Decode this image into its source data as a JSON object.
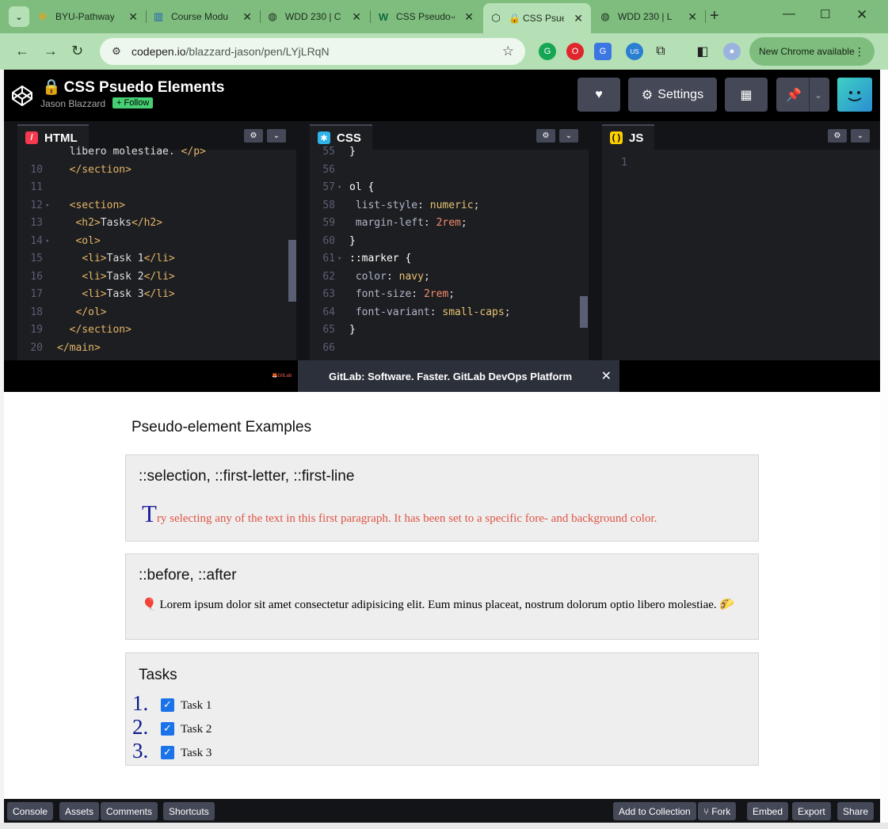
{
  "browser": {
    "tabs": [
      {
        "title": "BYU-Pathway",
        "icon": "byu-pathway-icon"
      },
      {
        "title": "Course Modu",
        "icon": "chart-bars-icon"
      },
      {
        "title": "WDD 230 | C",
        "icon": "globe-icon"
      },
      {
        "title": "CSS Pseudo-e",
        "icon": "w-icon"
      },
      {
        "title": "CSS Psued",
        "icon": "codepen-icon"
      },
      {
        "title": "WDD 230 | L",
        "icon": "globe-icon"
      }
    ],
    "address": {
      "host": "codepen.io",
      "path": "/blazzard-jason/pen/LYjLRqN"
    },
    "new_chrome_label": "New Chrome available",
    "extension_badge": "US"
  },
  "pen": {
    "title": "CSS Psuedo Elements",
    "author": "Jason Blazzard",
    "follow_label": "+ Follow",
    "settings_label": "Settings"
  },
  "editors": {
    "html": {
      "label": "HTML",
      "lines": [
        {
          "n": "",
          "fold": false,
          "text": "  libero molestiae. </p>"
        },
        {
          "n": "10",
          "fold": false,
          "text": "  </section>"
        },
        {
          "n": "11",
          "fold": false,
          "text": ""
        },
        {
          "n": "12",
          "fold": true,
          "text": "  <section>"
        },
        {
          "n": "13",
          "fold": false,
          "text": "   <h2>Tasks</h2>"
        },
        {
          "n": "14",
          "fold": true,
          "text": "   <ol>"
        },
        {
          "n": "15",
          "fold": false,
          "text": "    <li>Task 1</li>"
        },
        {
          "n": "16",
          "fold": false,
          "text": "    <li>Task 2</li>"
        },
        {
          "n": "17",
          "fold": false,
          "text": "    <li>Task 3</li>"
        },
        {
          "n": "18",
          "fold": false,
          "text": "   </ol>"
        },
        {
          "n": "19",
          "fold": false,
          "text": "  </section>"
        },
        {
          "n": "20",
          "fold": false,
          "text": "</main>"
        }
      ]
    },
    "css": {
      "label": "CSS",
      "lines": [
        {
          "n": "55",
          "fold": false,
          "text": "}"
        },
        {
          "n": "56",
          "fold": false,
          "text": ""
        },
        {
          "n": "57",
          "fold": true,
          "text": "ol {"
        },
        {
          "n": "58",
          "fold": false,
          "text": " list-style: numeric;"
        },
        {
          "n": "59",
          "fold": false,
          "text": " margin-left: 2rem;"
        },
        {
          "n": "60",
          "fold": false,
          "text": "}"
        },
        {
          "n": "61",
          "fold": true,
          "text": "::marker {"
        },
        {
          "n": "62",
          "fold": false,
          "text": " color: navy;"
        },
        {
          "n": "63",
          "fold": false,
          "text": " font-size: 2rem;"
        },
        {
          "n": "64",
          "fold": false,
          "text": " font-variant: small-caps;"
        },
        {
          "n": "65",
          "fold": false,
          "text": "}"
        },
        {
          "n": "66",
          "fold": false,
          "text": ""
        }
      ]
    },
    "js": {
      "label": "JS",
      "lines": [
        {
          "n": "1",
          "fold": false,
          "text": ""
        }
      ]
    }
  },
  "ad": {
    "small_label": "GitLab",
    "text": "GitLab: Software. Faster. GitLab DevOps Platform"
  },
  "preview": {
    "heading": "Pseudo-element Examples",
    "sections": [
      {
        "title": "::selection, ::first-letter, ::first-line",
        "first_letter": "T",
        "rest": "ry selecting any of the text in this first paragraph. It has been set to a specific fore- and background color."
      },
      {
        "title": "::before, ::after",
        "before_glyph": "🎈",
        "text": "Lorem ipsum dolor sit amet consectetur adipisicing elit. Eum minus placeat, nostrum dolorum optio libero molestiae.",
        "after_glyph": "🌮"
      },
      {
        "title": "Tasks",
        "tasks": [
          {
            "marker": "1.",
            "label": "Task 1",
            "checked": true
          },
          {
            "marker": "2.",
            "label": "Task 2",
            "checked": true
          },
          {
            "marker": "3.",
            "label": "Task 3",
            "checked": true
          }
        ]
      }
    ]
  },
  "bottom_bar": {
    "left": [
      "Console",
      "Assets",
      "Comments",
      "Shortcuts"
    ],
    "right": [
      "Add to Collection",
      "Fork",
      "Embed",
      "Export",
      "Share"
    ]
  },
  "colors": {
    "browser_frame": "#7fbd7f",
    "marker": "#0b1a8c",
    "red_text": "#e05445",
    "follow": "#47cf73"
  }
}
